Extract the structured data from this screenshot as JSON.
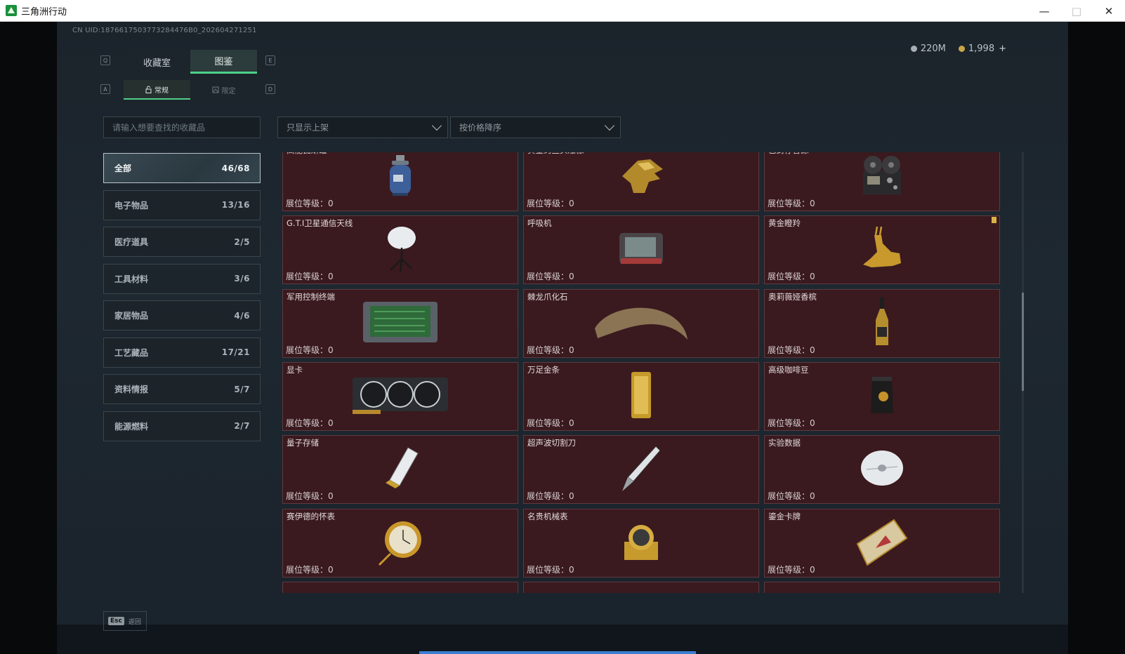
{
  "window": {
    "title": "三角洲行动"
  },
  "uid": "CN UID:1876617503773284476B0_202604271251",
  "currency": {
    "silver": "220M",
    "gold": "1,998",
    "plus": "+"
  },
  "keys": {
    "tab_left": "Q",
    "tab_right": "E",
    "sub_left": "A",
    "sub_right": "D"
  },
  "main_tabs": [
    {
      "label": "收藏室"
    },
    {
      "label": "图鉴"
    }
  ],
  "sub_tabs": [
    {
      "label": "常规"
    },
    {
      "label": "限定"
    }
  ],
  "search": {
    "placeholder": "请输入想要查找的收藏品"
  },
  "filters": {
    "shelf": "只显示上架",
    "sort": "按价格降序"
  },
  "categories": [
    {
      "label": "全部",
      "count": "46/68"
    },
    {
      "label": "电子物品",
      "count": "13/16"
    },
    {
      "label": "医疗道具",
      "count": "2/5"
    },
    {
      "label": "工具材料",
      "count": "3/6"
    },
    {
      "label": "家居物品",
      "count": "4/6"
    },
    {
      "label": "工艺藏品",
      "count": "17/21"
    },
    {
      "label": "资料情报",
      "count": "5/7"
    },
    {
      "label": "能源燃料",
      "count": "2/7"
    }
  ],
  "level_label": "展位等级：",
  "level_value": "0",
  "items": [
    {
      "name": "高能瓦斯罐",
      "icon": "gas-canister-icon"
    },
    {
      "name": "黄金鳄鱼头雕像",
      "icon": "gold-crocodile-statue-icon"
    },
    {
      "name": "已封存音源",
      "icon": "reel-recorder-icon"
    },
    {
      "name": "G.T.I卫星通信天线",
      "icon": "satellite-antenna-icon"
    },
    {
      "name": "呼吸机",
      "icon": "ventilator-icon"
    },
    {
      "name": "黄金瞪羚",
      "icon": "gold-gazelle-icon"
    },
    {
      "name": "军用控制终端",
      "icon": "control-terminal-icon"
    },
    {
      "name": "棘龙爪化石",
      "icon": "claw-fossil-icon"
    },
    {
      "name": "奥莉薇娅香槟",
      "icon": "champagne-icon"
    },
    {
      "name": "显卡",
      "icon": "graphics-card-icon"
    },
    {
      "name": "万足金条",
      "icon": "gold-bar-icon"
    },
    {
      "name": "高级咖啡豆",
      "icon": "coffee-beans-icon"
    },
    {
      "name": "量子存储",
      "icon": "quantum-storage-icon"
    },
    {
      "name": "超声波切割刀",
      "icon": "ultrasonic-knife-icon"
    },
    {
      "name": "实验数据",
      "icon": "data-disc-icon"
    },
    {
      "name": "赛伊德的怀表",
      "icon": "pocket-watch-icon"
    },
    {
      "name": "名贵机械表",
      "icon": "mechanical-watch-icon"
    },
    {
      "name": "鎏金卡牌",
      "icon": "gilded-card-icon"
    }
  ],
  "footer": {
    "key": "Esc",
    "label": "返回"
  }
}
